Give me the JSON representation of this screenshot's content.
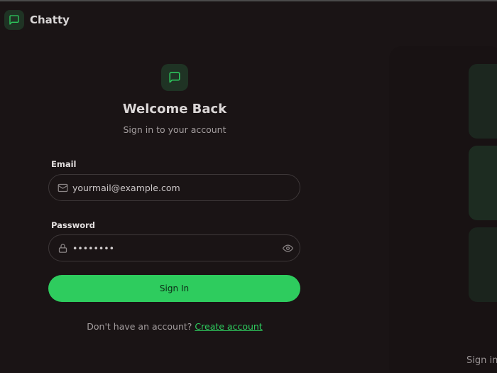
{
  "header": {
    "brand_name": "Chatty",
    "brand_icon": "message-square-icon"
  },
  "login": {
    "logo_icon": "message-square-icon",
    "title": "Welcome Back",
    "subtitle": "Sign in to your account",
    "email": {
      "label": "Email",
      "placeholder": "yourmail@example.com",
      "icon": "mail-icon"
    },
    "password": {
      "label": "Password",
      "value": "••••••••",
      "icon": "lock-icon",
      "toggle_icon": "eye-icon"
    },
    "submit_label": "Sign In",
    "footer_text": "Don't have an account? ",
    "create_account_link": "Create account"
  },
  "side_panel": {
    "text": "Sign in t"
  },
  "colors": {
    "accent": "#2ecc5e",
    "background": "#1a1415",
    "icon_tile": "#1f3324"
  }
}
